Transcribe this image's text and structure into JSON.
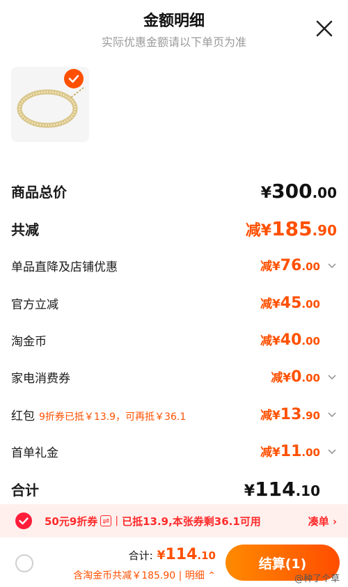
{
  "header": {
    "title": "金额明细",
    "subtitle": "实际优惠金额请以下单页为准"
  },
  "rows": {
    "total_price": {
      "label": "商品总价",
      "prefix": "¥",
      "int": "300",
      "dec": ".00"
    },
    "total_reduce": {
      "label": "共减",
      "prefix": "减¥",
      "int": "185",
      "dec": ".90"
    },
    "direct": {
      "label": "单品直降及店铺优惠",
      "prefix": "减¥",
      "int": "76",
      "dec": ".00"
    },
    "official": {
      "label": "官方立减",
      "prefix": "减¥",
      "int": "45",
      "dec": ".00"
    },
    "taojinbi": {
      "label": "淘金币",
      "prefix": "减¥",
      "int": "40",
      "dec": ".00"
    },
    "appliance": {
      "label": "家电消费券",
      "prefix": "减¥",
      "int": "0",
      "dec": ".00"
    },
    "hongbao": {
      "label": "红包",
      "note": "9折券已抵￥13.9，可再抵￥36.1",
      "prefix": "减¥",
      "int": "13",
      "dec": ".90"
    },
    "first_order": {
      "label": "首单礼金",
      "prefix": "减¥",
      "int": "11",
      "dec": ".00"
    },
    "sum": {
      "label": "合计",
      "prefix": "¥",
      "int": "114",
      "dec": ".10"
    }
  },
  "coupon": {
    "title": "50元9折券",
    "swap": "⇌",
    "detail": "已抵13.9,本张券剩36.1可用",
    "link": "凑单 ›"
  },
  "footer": {
    "total_label": "合计:",
    "total_prefix": "¥",
    "total_int": "114",
    "total_dec": ".10",
    "sub": "含淘金币共减￥185.90 | 明细 ⌃",
    "settle": "结算(1)",
    "watermark": "@种了个草"
  },
  "colors": {
    "accent": "#ff5000",
    "coupon_red": "#ff2b2b"
  }
}
